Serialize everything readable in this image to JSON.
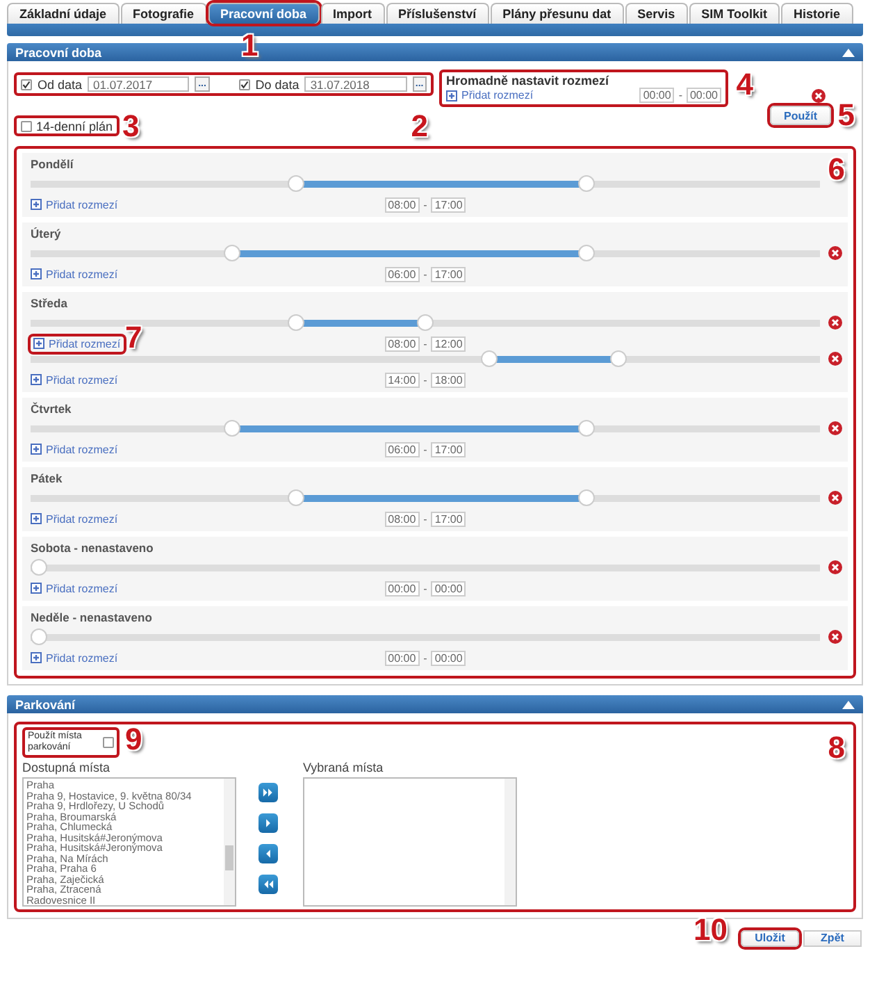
{
  "tabs": [
    {
      "label": "Základní údaje",
      "selected": false
    },
    {
      "label": "Fotografie",
      "selected": false
    },
    {
      "label": "Pracovní doba",
      "selected": true,
      "callout": "1"
    },
    {
      "label": "Import",
      "selected": false
    },
    {
      "label": "Příslušenství",
      "selected": false
    },
    {
      "label": "Plány přesunu dat",
      "selected": false
    },
    {
      "label": "Servis",
      "selected": false
    },
    {
      "label": "SIM Toolkit",
      "selected": false
    },
    {
      "label": "Historie",
      "selected": false
    }
  ],
  "work_hours": {
    "title": "Pracovní doba",
    "date_range": {
      "callout": "2",
      "from": {
        "label": "Od data",
        "checked": true,
        "value": "01.07.2017",
        "picker": "..."
      },
      "to": {
        "label": "Do data",
        "checked": true,
        "value": "31.07.2018",
        "picker": "..."
      }
    },
    "plan_14": {
      "label": "14-denní plán",
      "checked": false,
      "callout": "3"
    },
    "bulk": {
      "callout": "4",
      "title": "Hromadně nastavit rozmezí",
      "add_link": "Přidat rozmezí",
      "from": "00:00",
      "separator": "-",
      "to": "00:00",
      "removable": true
    },
    "apply": {
      "label": "Použít",
      "callout": "5"
    },
    "days_callout": "6",
    "days": [
      {
        "name": "Pondělí",
        "ranges": [
          {
            "thumbs": [
              {
                "level": 0.333
              },
              {
                "level": 0.708
              }
            ],
            "add_link": "Přidat rozmezí",
            "from": "08:00",
            "separator": "-",
            "to": "17:00",
            "removable": false
          }
        ]
      },
      {
        "name": "Úterý",
        "ranges": [
          {
            "thumbs": [
              {
                "level": 0.25
              },
              {
                "level": 0.708
              }
            ],
            "add_link": "Přidat rozmezí",
            "from": "06:00",
            "separator": "-",
            "to": "17:00",
            "removable": true
          }
        ]
      },
      {
        "name": "Středa",
        "ranges": [
          {
            "thumbs": [
              {
                "level": 0.333
              },
              {
                "level": 0.5
              }
            ],
            "add_link": "Přidat rozmezí",
            "from": "08:00",
            "separator": "-",
            "to": "12:00",
            "removable": true,
            "callout": "7"
          },
          {
            "thumbs": [
              {
                "level": 0.583
              },
              {
                "level": 0.75
              }
            ],
            "add_link": "Přidat rozmezí",
            "from": "14:00",
            "separator": "-",
            "to": "18:00",
            "removable": true
          }
        ]
      },
      {
        "name": "Čtvrtek",
        "ranges": [
          {
            "thumbs": [
              {
                "level": 0.25
              },
              {
                "level": 0.708
              }
            ],
            "add_link": "Přidat rozmezí",
            "from": "06:00",
            "separator": "-",
            "to": "17:00",
            "removable": true
          }
        ]
      },
      {
        "name": "Pátek",
        "ranges": [
          {
            "thumbs": [
              {
                "level": 0.333
              },
              {
                "level": 0.708
              }
            ],
            "add_link": "Přidat rozmezí",
            "from": "08:00",
            "separator": "-",
            "to": "17:00",
            "removable": true
          }
        ]
      },
      {
        "name": "Sobota - nenastaveno",
        "ranges": [
          {
            "thumbs": [
              {
                "level": 0
              }
            ],
            "add_link": "Přidat rozmezí",
            "from": "00:00",
            "separator": "-",
            "to": "00:00",
            "removable": true
          }
        ]
      },
      {
        "name": "Neděle - nenastaveno",
        "ranges": [
          {
            "thumbs": [
              {
                "level": 0
              }
            ],
            "add_link": "Přidat rozmezí",
            "from": "00:00",
            "separator": "-",
            "to": "00:00",
            "removable": true
          }
        ]
      }
    ]
  },
  "parking": {
    "title": "Parkování",
    "callout": "8",
    "use": {
      "label": "Použít místa parkování",
      "checked": false,
      "callout": "9"
    },
    "available": {
      "title": "Dostupná místa",
      "items": [
        "Praha",
        "Praha 9, Hostavice, 9. května 80/34",
        "Praha 9, Hrdlořezy, U Schodů",
        "Praha, Broumarská",
        "Praha, Chlumecká",
        "Praha, Husitská#Jeronýmova",
        "Praha, Husitská#Jeronýmova",
        "Praha, Na Mírách",
        "Praha, Praha 6",
        "Praha, Zaječická",
        "Praha, Ztracená",
        "Radovesnice II"
      ]
    },
    "chosen": {
      "title": "Vybraná místa"
    }
  },
  "buttons": [
    {
      "label": "Uložit",
      "callout": "10"
    },
    {
      "label": "Zpět"
    }
  ]
}
